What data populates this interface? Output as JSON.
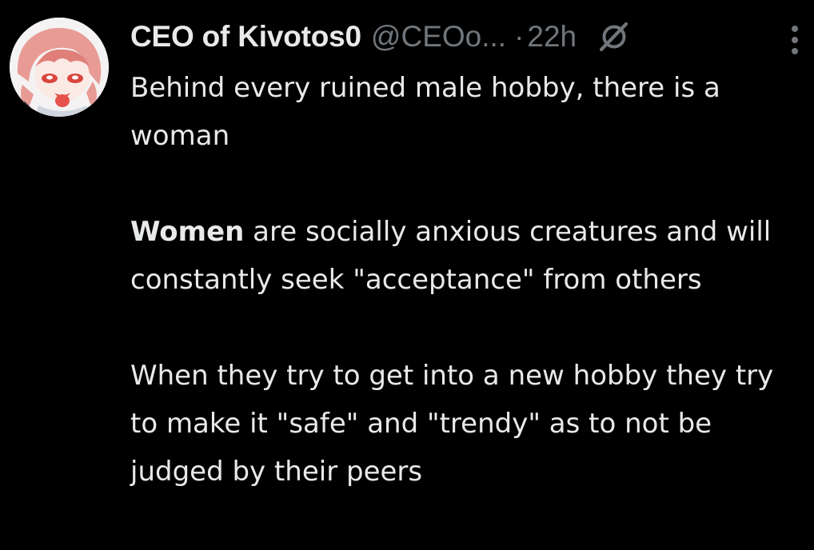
{
  "author": {
    "display_name": "CEO of Kivotos0",
    "handle": "@CEOo...",
    "separator": "·",
    "time": "22h",
    "avatar_icon": "anime-character-avatar",
    "grok_icon": "grok-slash-icon",
    "more_icon": "more-options-icon"
  },
  "tweet": {
    "para1": "Behind every ruined male hobby, there is a woman",
    "para2_bold": "Women",
    "para2_rest": " are socially anxious creatures and will constantly seek \"acceptance\" from others",
    "para3": "When they try to get into a new hobby they try to make it \"safe\" and \"trendy\" as to not be judged by their peers"
  },
  "colors": {
    "background": "#000000",
    "text_primary": "#e7e9ea",
    "text_secondary": "#71767b"
  }
}
